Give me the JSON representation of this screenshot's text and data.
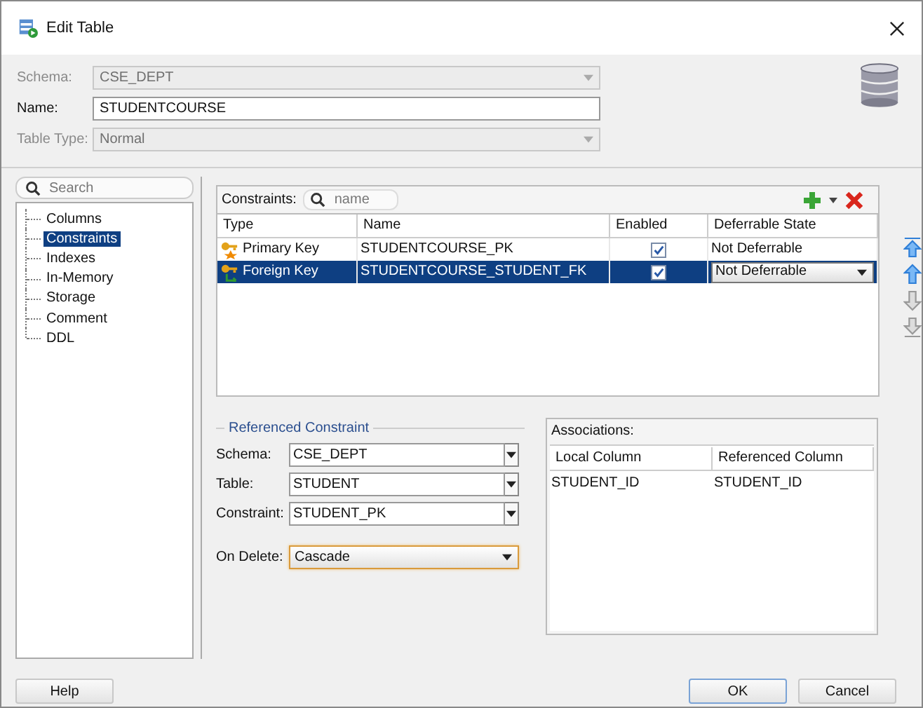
{
  "window": {
    "title": "Edit Table"
  },
  "table_fields": [
    {
      "label": "Schema:",
      "value": "CSE_DEPT",
      "kind": "dropdown",
      "disabled": true
    },
    {
      "label": "Name:",
      "value": "STUDENTCOURSE",
      "kind": "text",
      "disabled": false
    },
    {
      "label": "Table Type:",
      "value": "Normal",
      "kind": "dropdown",
      "disabled": true
    }
  ],
  "navigator": {
    "search_placeholder": "Search",
    "items": [
      {
        "label": "Columns",
        "selected": false
      },
      {
        "label": "Constraints",
        "selected": true
      },
      {
        "label": "Indexes",
        "selected": false
      },
      {
        "label": "In-Memory",
        "selected": false
      },
      {
        "label": "Storage",
        "selected": false
      },
      {
        "label": "Comment",
        "selected": false
      },
      {
        "label": "DDL",
        "selected": false
      }
    ]
  },
  "constraints": {
    "label": "Constraints:",
    "search_placeholder": "name",
    "columns": [
      "Type",
      "Name",
      "Enabled",
      "Deferrable State"
    ],
    "rows": [
      {
        "kind": "primary",
        "type": "Primary Key",
        "name": "STUDENTCOURSE_PK",
        "enabled": true,
        "deferrable_state": "Not Deferrable",
        "selected": false
      },
      {
        "kind": "foreign",
        "type": "Foreign Key",
        "name": "STUDENTCOURSE_STUDENT_FK",
        "enabled": true,
        "deferrable_state": "Not Deferrable",
        "selected": true
      }
    ]
  },
  "referenced_constraint": {
    "title": "Referenced Constraint",
    "fields": [
      {
        "label": "Schema:",
        "value": "CSE_DEPT"
      },
      {
        "label": "Table:",
        "value": "STUDENT"
      },
      {
        "label": "Constraint:",
        "value": "STUDENT_PK"
      }
    ],
    "on_delete": {
      "label": "On Delete:",
      "value": "Cascade"
    }
  },
  "associations": {
    "title": "Associations:",
    "columns": [
      "Local Column",
      "Referenced Column"
    ],
    "rows": [
      [
        "STUDENT_ID",
        "STUDENT_ID"
      ]
    ]
  },
  "buttons": [
    {
      "label": "Help",
      "kind": "help",
      "default": false
    },
    {
      "label": "OK",
      "kind": "ok",
      "default": true
    },
    {
      "label": "Cancel",
      "kind": "cancel",
      "default": false
    }
  ]
}
